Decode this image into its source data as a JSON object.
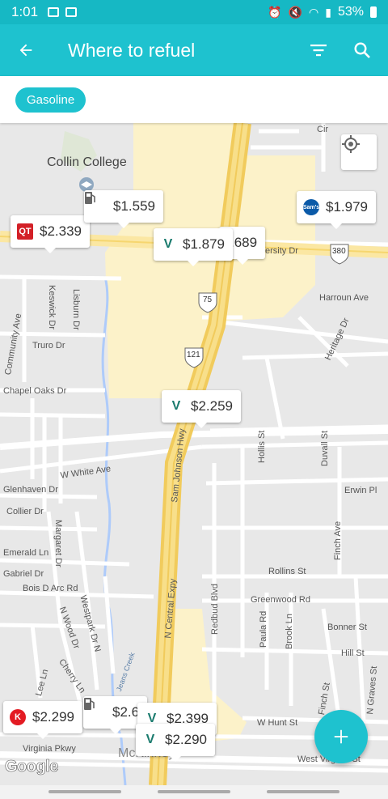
{
  "status": {
    "time": "1:01",
    "battery": "53%"
  },
  "appbar": {
    "title": "Where to refuel"
  },
  "filter": {
    "chip": "Gasoline"
  },
  "map": {
    "labels": {
      "college": "Collin College",
      "university": "University Dr",
      "harroun": "Harroun Ave",
      "heritage": "Heritage Dr",
      "keswick": "Keswick Dr",
      "lisburn": "Lisburn Dr",
      "community": "Community Ave",
      "truro": "Truro Dr",
      "chapel": "Chapel Oaks Dr",
      "white": "W White Ave",
      "glenhaven": "Glenhaven Dr",
      "collier": "Collier Dr",
      "margaret": "Margaret Dr",
      "emerald": "Emerald Ln",
      "gabriel": "Gabriel Dr",
      "boisdarc": "Bois D Arc Rd",
      "nwood": "N Wood Dr",
      "westpark": "Westpark Dr N",
      "cherry": "Cherry Ln",
      "lee": "Lee Ln",
      "jeans": "Jeans Creek",
      "samjohnson": "Sam Johnson Hwy",
      "ncentral": "N Central Expy",
      "hollis": "Hollis St",
      "duvall": "Duvall St",
      "erwin": "Erwin Pl",
      "finchave": "Finch Ave",
      "rollins": "Rollins St",
      "greenwood": "Greenwood Rd",
      "redbud": "Redbud Blvd",
      "paula": "Paula Rd",
      "brook": "Brook Ln",
      "bonner": "Bonner St",
      "hill": "Hill St",
      "finchst": "Finch St",
      "ngraves": "N Graves St",
      "whunt": "W Hunt St",
      "virginia": "Virginia Pkwy",
      "wvirginia": "West Virginia St",
      "mckinney": "McKinney",
      "cir": "Cir",
      "shield75": "75",
      "shield121": "121",
      "shield380": "380"
    },
    "pins": [
      {
        "price": "$2.339",
        "brand": "QT"
      },
      {
        "price": "$1.559",
        "brand": "pump"
      },
      {
        "price": "$1.879",
        "brand": "V"
      },
      {
        "price": ".689",
        "brand": ""
      },
      {
        "price": "$1.979",
        "brand": "Sam's"
      },
      {
        "price": "$2.259",
        "brand": "V"
      },
      {
        "price": "$2.299",
        "brand": "K"
      },
      {
        "price": "$2.6",
        "brand": "pump"
      },
      {
        "price": "$2.399",
        "brand": "V"
      },
      {
        "price": "$2.290",
        "brand": "V"
      }
    ],
    "attribution": "Google"
  },
  "colors": {
    "accent": "#1ec2cf",
    "status": "#16b8c4",
    "highway": "#f6d66f",
    "commercial": "#fcf2c9"
  }
}
